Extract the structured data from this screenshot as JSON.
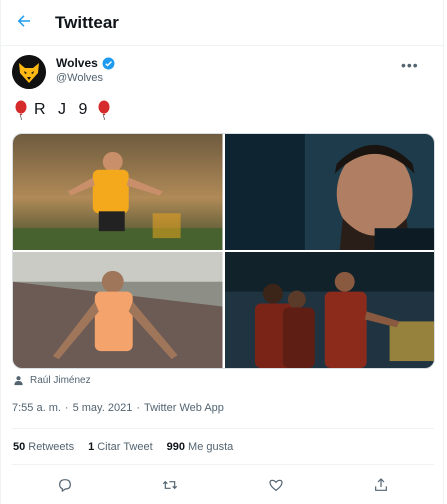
{
  "header": {
    "title": "Twittear"
  },
  "tweet": {
    "author_name": "Wolves",
    "author_handle": "@Wolves",
    "text_letters": "R J 9",
    "tagged_user": "Raúl Jiménez",
    "time": "7:55 a. m.",
    "separator": "·",
    "date": "5 may. 2021",
    "source": "Twitter Web App"
  },
  "stats": {
    "retweets_count": "50",
    "retweets_label": "Retweets",
    "quotes_count": "1",
    "quotes_label": "Citar Tweet",
    "likes_count": "990",
    "likes_label": "Me gusta"
  },
  "colors": {
    "accent": "#1d9bf0",
    "wolves_gold": "#fdb913",
    "wolves_black": "#231f20"
  },
  "icons": [
    "back-arrow-icon",
    "verified-icon",
    "more-icon",
    "balloon-icon",
    "person-tag-icon",
    "reply-icon",
    "retweet-icon",
    "like-icon",
    "share-icon"
  ]
}
